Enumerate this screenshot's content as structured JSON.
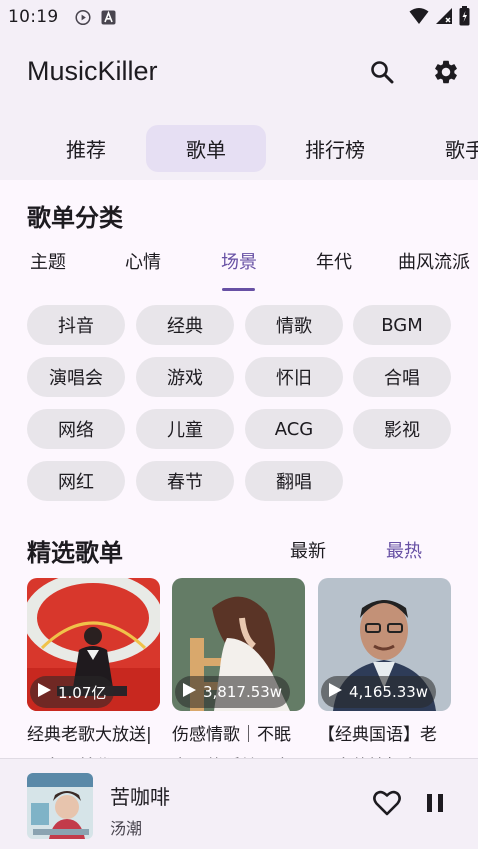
{
  "status_bar": {
    "time": "10:19"
  },
  "app_bar": {
    "title": "MusicKiller"
  },
  "top_tabs": [
    {
      "label": "推荐"
    },
    {
      "label": "歌单"
    },
    {
      "label": "排行榜"
    },
    {
      "label": "歌手"
    }
  ],
  "categories": {
    "section_title": "歌单分类",
    "tabs": [
      {
        "label": "主题"
      },
      {
        "label": "心情"
      },
      {
        "label": "场景"
      },
      {
        "label": "年代"
      },
      {
        "label": "曲风流派"
      }
    ],
    "active_tab": "场景",
    "chips": [
      "抖音",
      "经典",
      "情歌",
      "BGM",
      "演唱会",
      "游戏",
      "怀旧",
      "合唱",
      "网络",
      "儿童",
      "ACG",
      "影视",
      "网红",
      "春节",
      "翻唱"
    ]
  },
  "featured": {
    "section_title": "精选歌单",
    "sort_options": [
      {
        "label": "最新"
      },
      {
        "label": "最热"
      }
    ],
    "active_sort": "最热",
    "playlists": [
      {
        "play_count": "1.07亿",
        "title": "经典老歌大放送| 一人一首代"
      },
      {
        "play_count": "3,817.53w",
        "title": "伤感情歌｜不眠夜里的孤单心事"
      },
      {
        "play_count": "4,165.33w",
        "title": "【经典国语】老男人的情怀有思"
      }
    ]
  },
  "player": {
    "title": "苦咖啡",
    "artist": "汤潮"
  },
  "colors": {
    "accent": "#6750a4",
    "background": "#f4eff7",
    "surface": "#fdf7fe",
    "chip": "#e8e5ea",
    "active_tab_bg": "#e6dff3"
  },
  "icons": {
    "search": "search-icon",
    "settings": "gear-icon",
    "play": "play-icon",
    "favorite": "heart-outline-icon",
    "pause": "pause-icon"
  }
}
